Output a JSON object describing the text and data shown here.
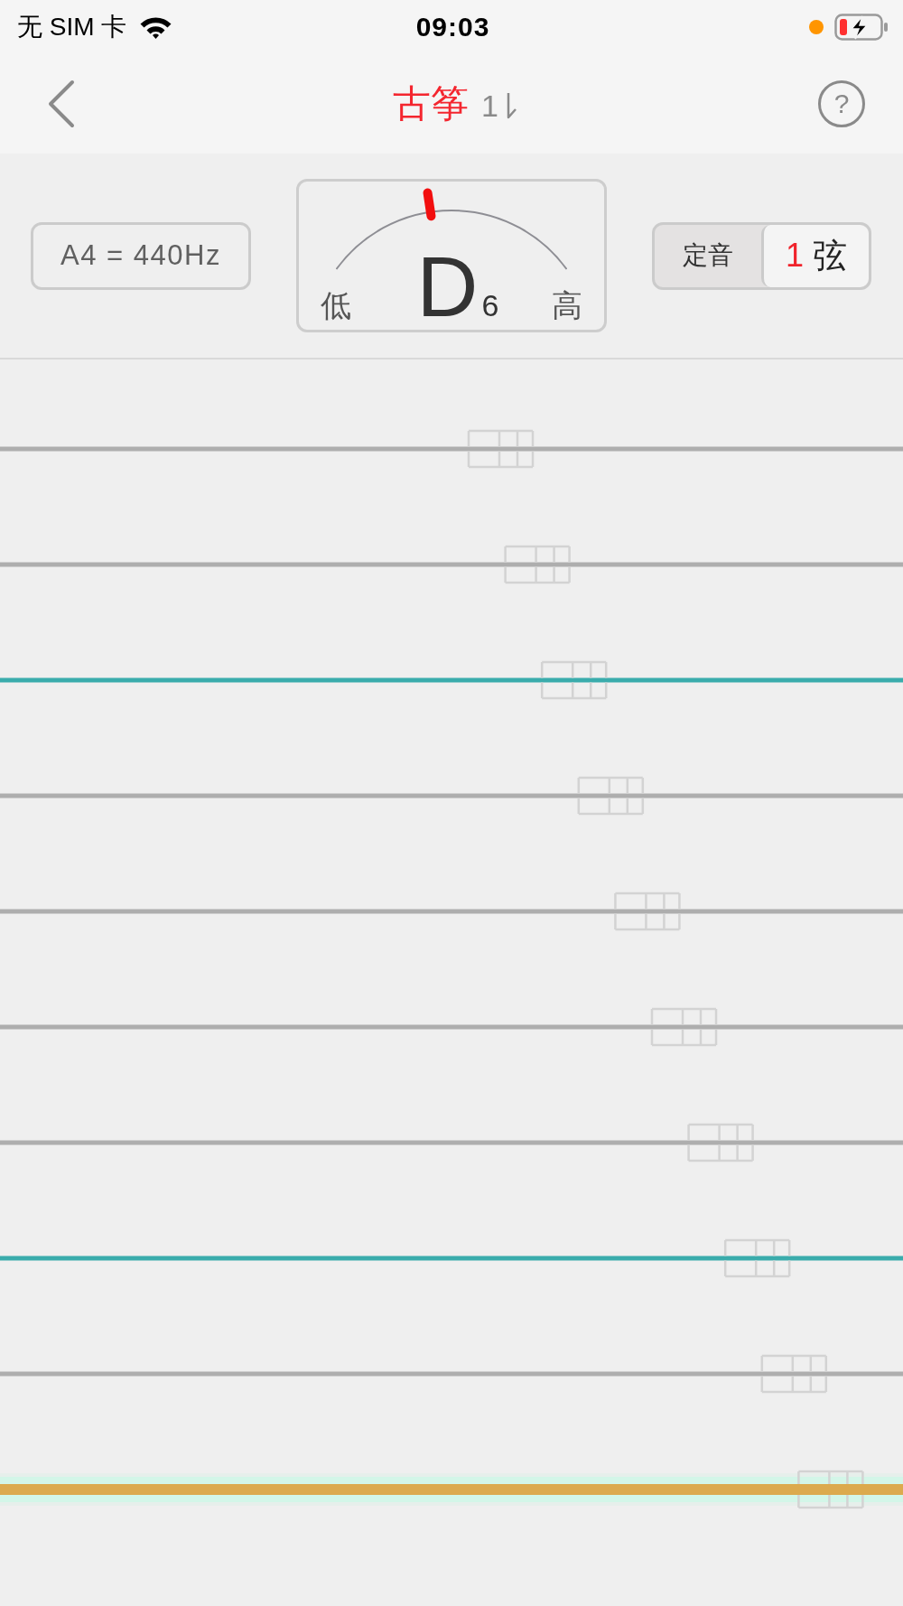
{
  "status_bar": {
    "carrier": "无 SIM 卡",
    "time": "09:03"
  },
  "nav": {
    "title": "古筝",
    "tuning": "1",
    "help_label": "?"
  },
  "reference": {
    "label": "A4 = 440Hz"
  },
  "meter": {
    "low_label": "低",
    "high_label": "高",
    "note": "D",
    "octave": "6",
    "level": 0.42
  },
  "mode": {
    "label": "定音",
    "string_number": "1",
    "string_unit": "弦"
  },
  "strings": [
    {
      "kind": "plain",
      "selected": false
    },
    {
      "kind": "plain",
      "selected": false
    },
    {
      "kind": "accent",
      "selected": false
    },
    {
      "kind": "plain",
      "selected": false
    },
    {
      "kind": "plain",
      "selected": false
    },
    {
      "kind": "plain",
      "selected": false
    },
    {
      "kind": "plain",
      "selected": false
    },
    {
      "kind": "accent",
      "selected": false
    },
    {
      "kind": "plain",
      "selected": false
    },
    {
      "kind": "plain",
      "selected": true
    }
  ]
}
